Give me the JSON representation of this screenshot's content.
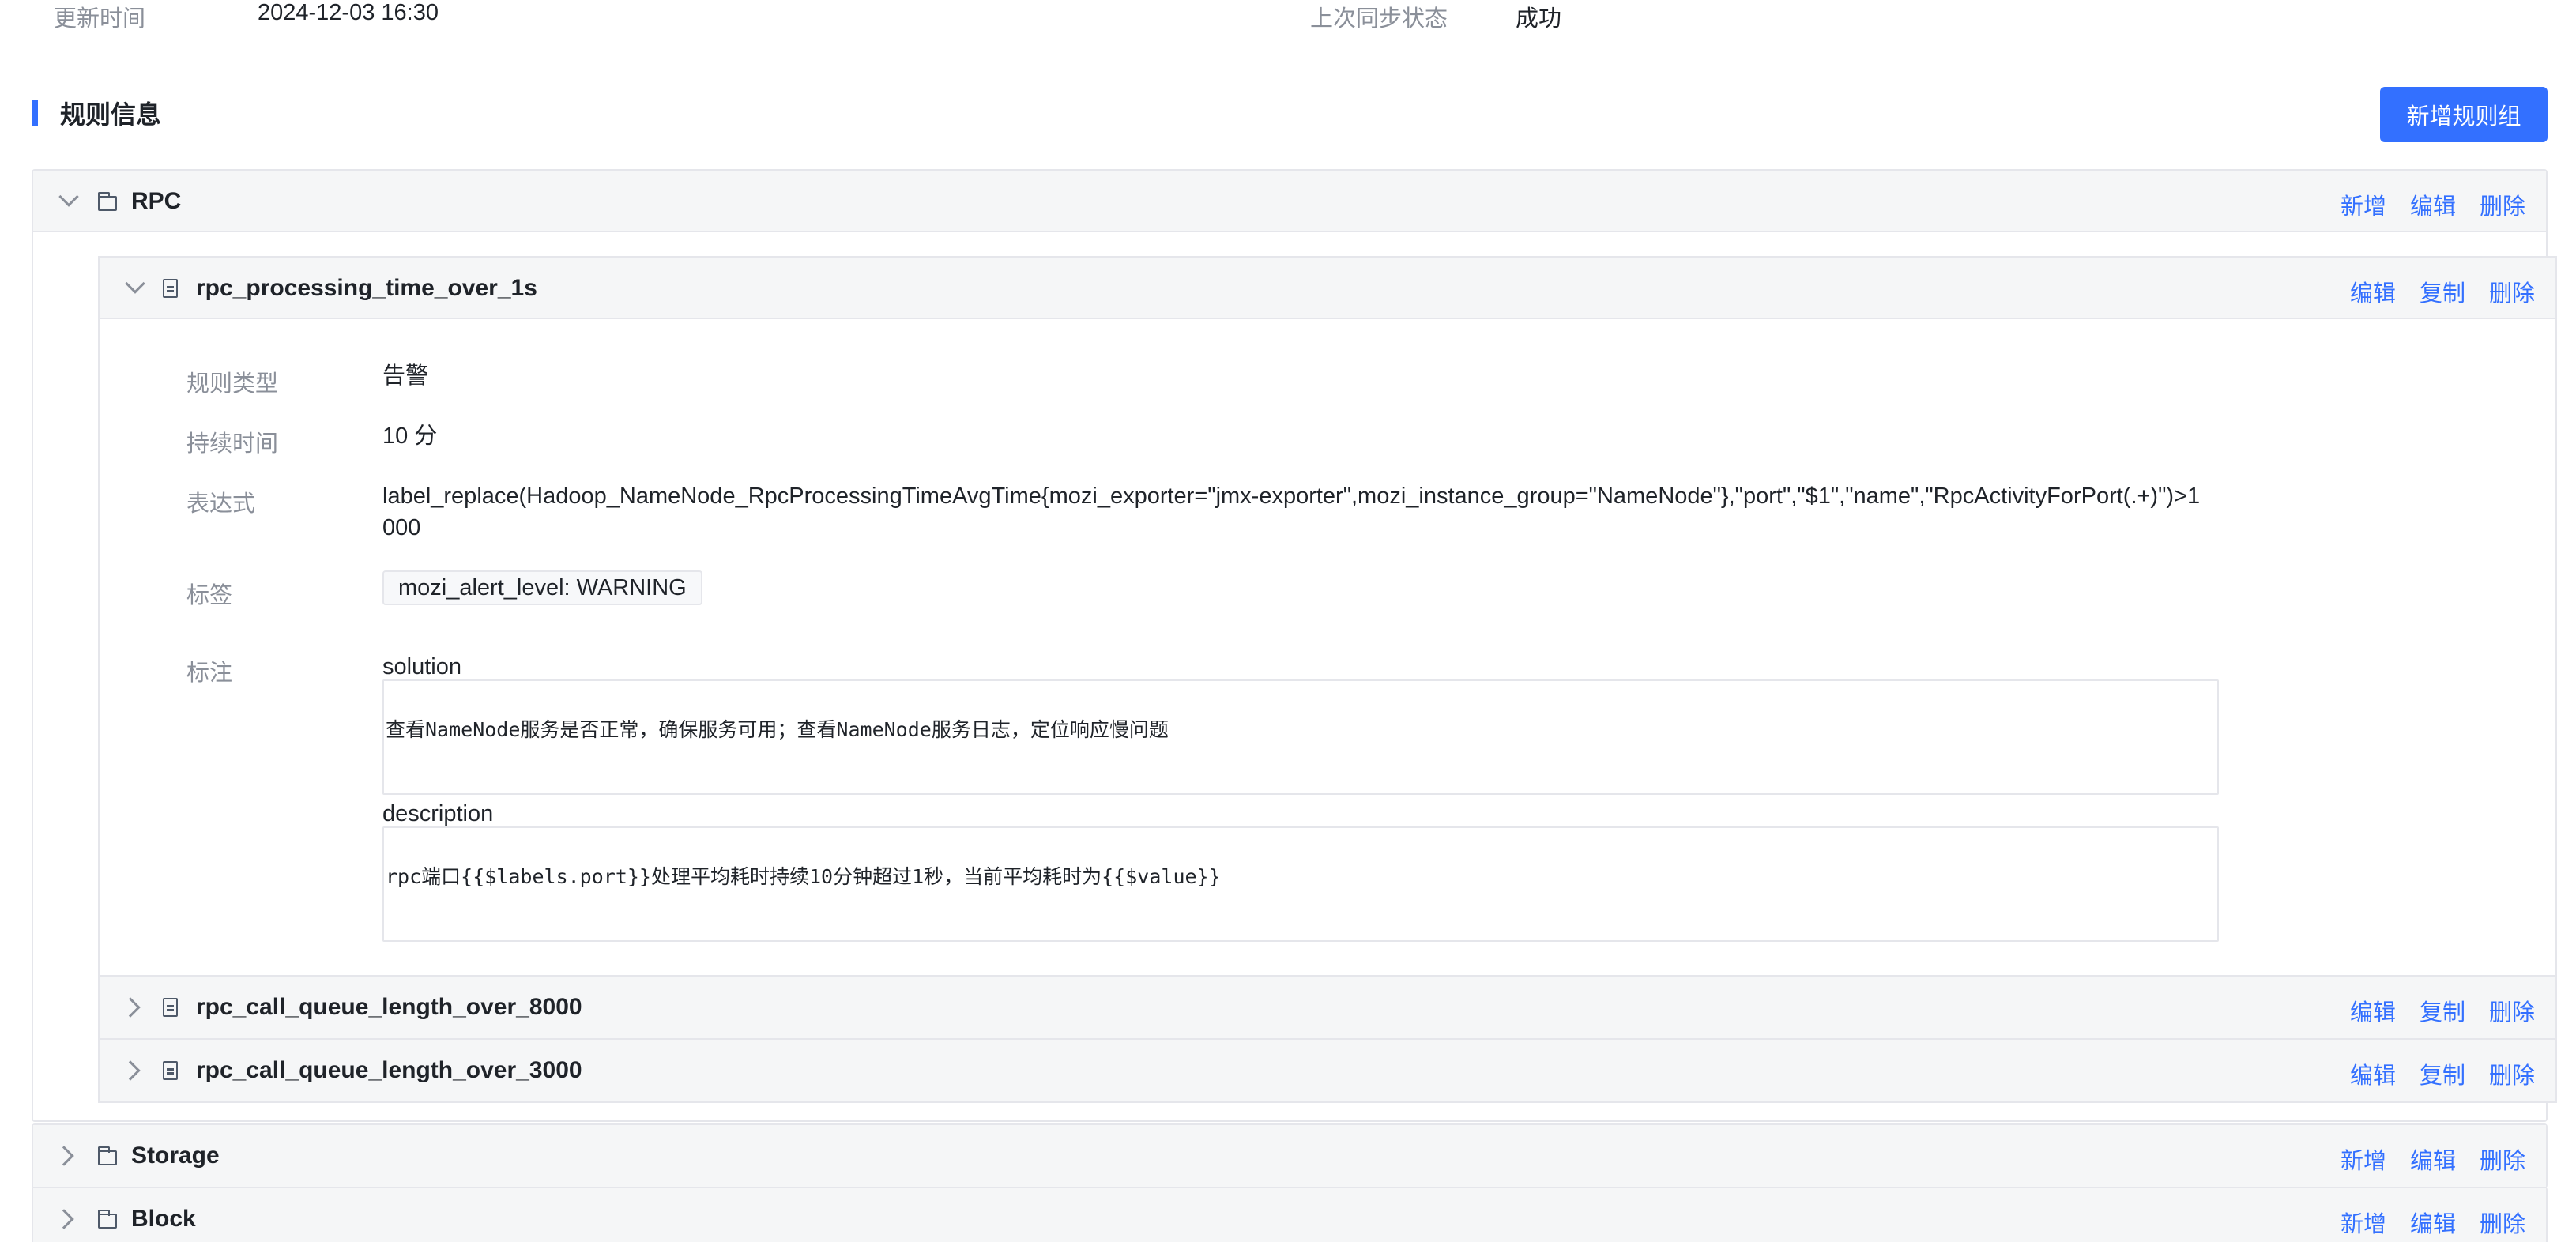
{
  "meta": {
    "updated_label": "更新时间",
    "updated_value": "2024-12-03 16:30",
    "sync_label": "上次同步状态",
    "sync_value": "成功"
  },
  "section": {
    "title": "规则信息",
    "add_group_label": "新增规则组"
  },
  "group_actions": {
    "add": "新增",
    "edit": "编辑",
    "delete": "删除"
  },
  "rule_actions": {
    "edit": "编辑",
    "copy": "复制",
    "delete": "删除"
  },
  "groups": [
    {
      "name": "RPC",
      "expanded": true
    },
    {
      "name": "Storage",
      "expanded": false
    },
    {
      "name": "Block",
      "expanded": false
    }
  ],
  "rules": [
    {
      "name": "rpc_processing_time_over_1s",
      "expanded": true,
      "labels": {
        "type": "规则类型",
        "duration": "持续时间",
        "expression": "表达式",
        "tags": "标签",
        "annotations": "标注"
      },
      "type": "告警",
      "duration": "10 分",
      "expression_line1": "label_replace(Hadoop_NameNode_RpcProcessingTimeAvgTime{mozi_exporter=\"jmx-exporter\",mozi_instance_group=\"NameNode\"},\"port\",\"$1\",\"name\",\"RpcActivityForPort(.+)\")>1",
      "expression_line2": "000",
      "tag": "mozi_alert_level: WARNING",
      "annotations": [
        {
          "key": "solution",
          "value": "查看NameNode服务是否正常，确保服务可用；查看NameNode服务日志，定位响应慢问题"
        },
        {
          "key": "description",
          "value": "rpc端口{{$labels.port}}处理平均耗时持续10分钟超过1秒，当前平均耗时为{{$value}}"
        }
      ]
    },
    {
      "name": "rpc_call_queue_length_over_8000",
      "expanded": false
    },
    {
      "name": "rpc_call_queue_length_over_3000",
      "expanded": false
    }
  ]
}
